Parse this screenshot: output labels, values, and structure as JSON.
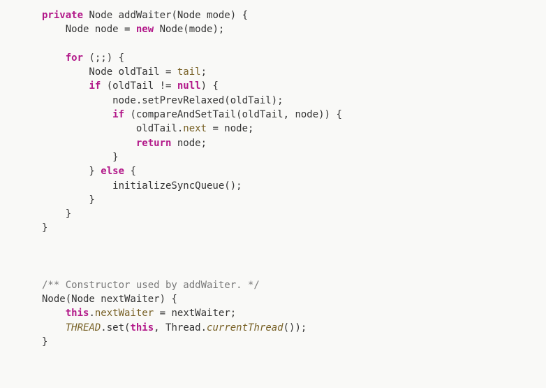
{
  "code": {
    "block1": {
      "t1": "private",
      "t2": " Node addWaiter(Node mode) {",
      "t3": "    Node node = ",
      "t4": "new",
      "t5": " Node(mode);",
      "blank1": "",
      "t6": "    ",
      "t7": "for",
      "t8": " (;;) {",
      "t9": "        Node oldTail = ",
      "t10": "tail",
      "t11": ";",
      "t12": "        ",
      "t13": "if",
      "t14": " (oldTail != ",
      "t15": "null",
      "t16": ") {",
      "t17": "            node.setPrevRelaxed(oldTail);",
      "t18": "            ",
      "t19": "if",
      "t20": " (compareAndSetTail(oldTail, node)) {",
      "t21": "                oldTail.",
      "t22": "next",
      "t23": " = node;",
      "t24": "                ",
      "t25": "return",
      "t26": " node;",
      "t27": "            }",
      "t28": "        } ",
      "t29": "else",
      "t30": " {",
      "t31": "            initializeSyncQueue();",
      "t32": "        }",
      "t33": "    }",
      "t34": "}"
    },
    "block2": {
      "c1": "/** Constructor used by addWaiter. */",
      "t1": "Node(Node nextWaiter) {",
      "t2": "    ",
      "t3": "this",
      "t4": ".",
      "t5": "nextWaiter",
      "t6": " = nextWaiter;",
      "t7": "    ",
      "t8": "THREAD",
      "t9": ".set(",
      "t10": "this",
      "t11": ", Thread.",
      "t12": "currentThread",
      "t13": "());",
      "t14": "}"
    }
  }
}
